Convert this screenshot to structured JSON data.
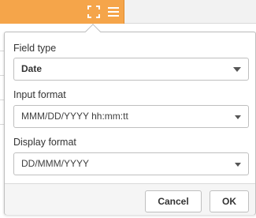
{
  "header": {
    "expand_icon": "expand-icon",
    "menu_icon": "hamburger-menu-icon",
    "accent_color": "#f5a54a"
  },
  "dialog": {
    "field_type": {
      "label": "Field type",
      "value": "Date"
    },
    "input_format": {
      "label": "Input format",
      "value": "MMM/DD/YYYY hh:mm:tt"
    },
    "display_format": {
      "label": "Display format",
      "value": "DD/MMM/YYYY"
    },
    "buttons": {
      "cancel": "Cancel",
      "ok": "OK"
    }
  }
}
